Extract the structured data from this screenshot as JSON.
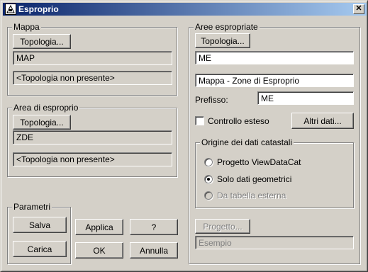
{
  "window": {
    "title": "Esproprio",
    "close_glyph": "✕"
  },
  "mappa": {
    "legend": "Mappa",
    "topologia_button": "Topologia...",
    "name_value": "MAP",
    "topology_value": "<Topologia non presente>"
  },
  "area_esproprio": {
    "legend": "Area di esproprio",
    "topologia_button": "Topologia...",
    "name_value": "ZDE",
    "topology_value": "<Topologia non presente>"
  },
  "parametri": {
    "legend": "Parametri",
    "salva_button": "Salva",
    "carica_button": "Carica"
  },
  "actions": {
    "applica_button": "Applica",
    "help_button": "?",
    "ok_button": "OK",
    "annulla_button": "Annulla"
  },
  "aree_espropriate": {
    "legend": "Aree espropriate",
    "topologia_button": "Topologia...",
    "name_value": "ME",
    "description_value": "Mappa - Zone di Esproprio",
    "prefisso_label": "Prefisso:",
    "prefisso_value": "ME",
    "controllo_label": "Controllo esteso",
    "controllo_checked": false,
    "altri_dati_button": "Altri dati...",
    "progetto_button": "Progetto...",
    "esempio_value": "Esempio"
  },
  "origine": {
    "legend": "Origine dei dati catastali",
    "options": [
      {
        "label": "Progetto ViewDataCat",
        "checked": false,
        "enabled": true
      },
      {
        "label": "Solo dati geometrici",
        "checked": true,
        "enabled": true
      },
      {
        "label": "Da tabella esterna",
        "checked": false,
        "enabled": false
      }
    ]
  }
}
